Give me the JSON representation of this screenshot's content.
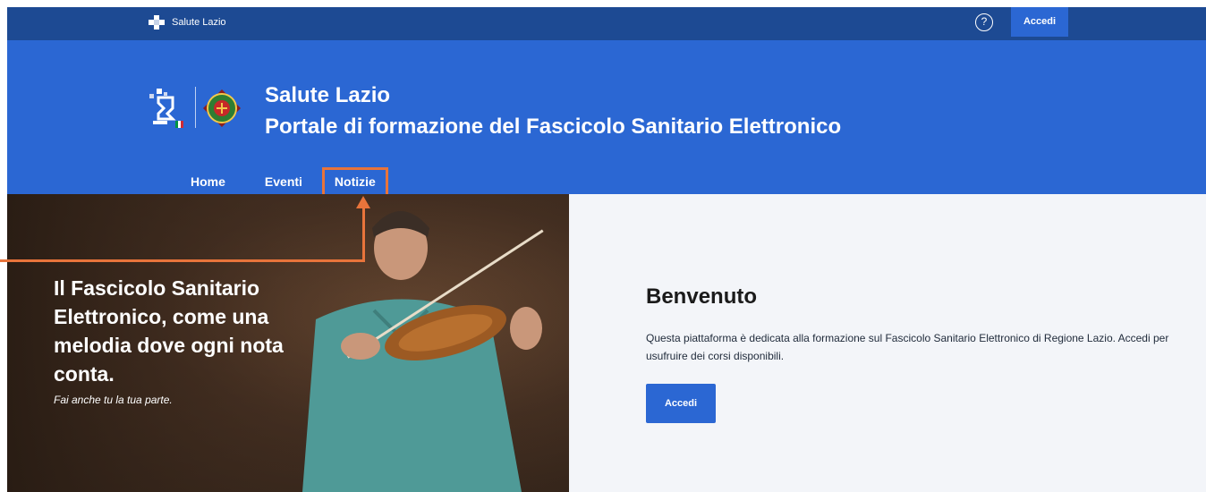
{
  "topbar": {
    "brand_label": "Salute Lazio",
    "help_icon_glyph": "?",
    "login_label": "Accedi"
  },
  "header": {
    "title_line1": "Salute Lazio",
    "title_line2": "Portale di formazione del Fascicolo Sanitario Elettronico",
    "icons": [
      "fse-logo-icon",
      "regione-lazio-emblem-icon"
    ]
  },
  "nav": {
    "items": [
      {
        "label": "Home",
        "active": true
      },
      {
        "label": "Eventi",
        "active": false
      },
      {
        "label": "Notizie",
        "active": false,
        "highlighted": true
      }
    ]
  },
  "hero": {
    "title": "Il Fascicolo Sanitario Elettronico, come una melodia dove ogni nota conta.",
    "subtitle": "Fai anche tu la tua parte.",
    "image_subject": "man-playing-violin"
  },
  "content": {
    "title": "Benvenuto",
    "text": "Questa piattaforma è dedicata alla formazione sul Fascicolo Sanitario Elettronico di Regione Lazio. Accedi per usufruire dei corsi disponibili.",
    "button_label": "Accedi"
  },
  "colors": {
    "topbar": "#1d4a93",
    "header": "#2b67d3",
    "annotation": "#e8743b",
    "content_bg": "#f3f5f9"
  }
}
